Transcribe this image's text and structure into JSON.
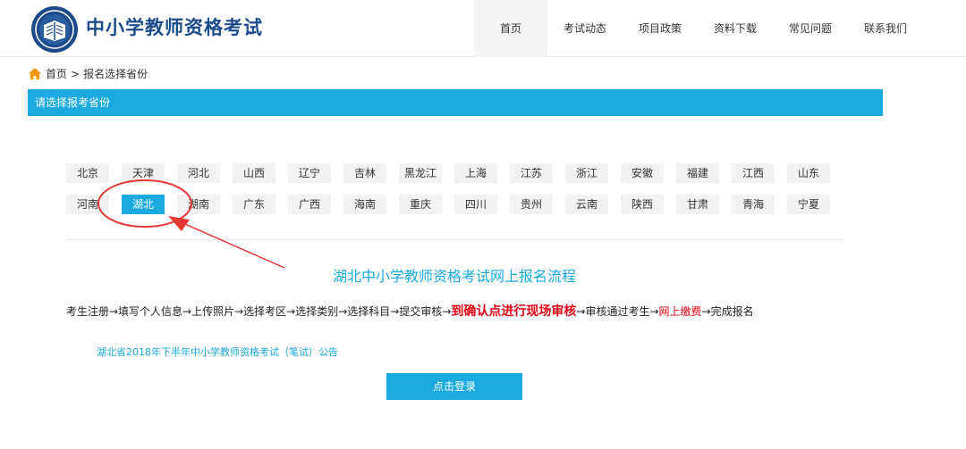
{
  "header": {
    "site_title": "中小学教师资格考试",
    "logo_icon": "emblem-book-icon",
    "nav": [
      "首页",
      "考试动态",
      "项目政策",
      "资料下载",
      "常见问题",
      "联系我们"
    ],
    "active_nav": "首页"
  },
  "breadcrumb": {
    "icon": "home-icon",
    "home": "首页",
    "separator": ">",
    "current": "报名选择省份"
  },
  "section": {
    "title": "请选择报考省份"
  },
  "provinces": {
    "row1": [
      "北京",
      "天津",
      "河北",
      "山西",
      "辽宁",
      "吉林",
      "黑龙江",
      "上海",
      "江苏",
      "浙江",
      "安徽",
      "福建",
      "江西",
      "山东"
    ],
    "row2": [
      "河南",
      "湖北",
      "湖南",
      "广东",
      "广西",
      "海南",
      "重庆",
      "四川",
      "贵州",
      "云南",
      "陕西",
      "甘肃",
      "青海",
      "宁夏"
    ],
    "selected": "湖北"
  },
  "flow": {
    "title": "湖北中小学教师资格考试网上报名流程",
    "part1": "考生注册→填写个人信息→上传照片→选择考区→选择类别→选择科目→提交审核→",
    "highlight1": "到确认点进行现场审核",
    "part2": "→审核通过考生→",
    "highlight2": "网上缴费",
    "part3": "→完成报名"
  },
  "notice": {
    "text": "湖北省2018年下半年中小学教师资格考试（笔试）公告"
  },
  "login_button": {
    "label": "点击登录"
  },
  "colors": {
    "accent": "#1aaae0",
    "brand": "#1b4b8a",
    "highlight": "#e60012",
    "annotation": "#e53935"
  }
}
